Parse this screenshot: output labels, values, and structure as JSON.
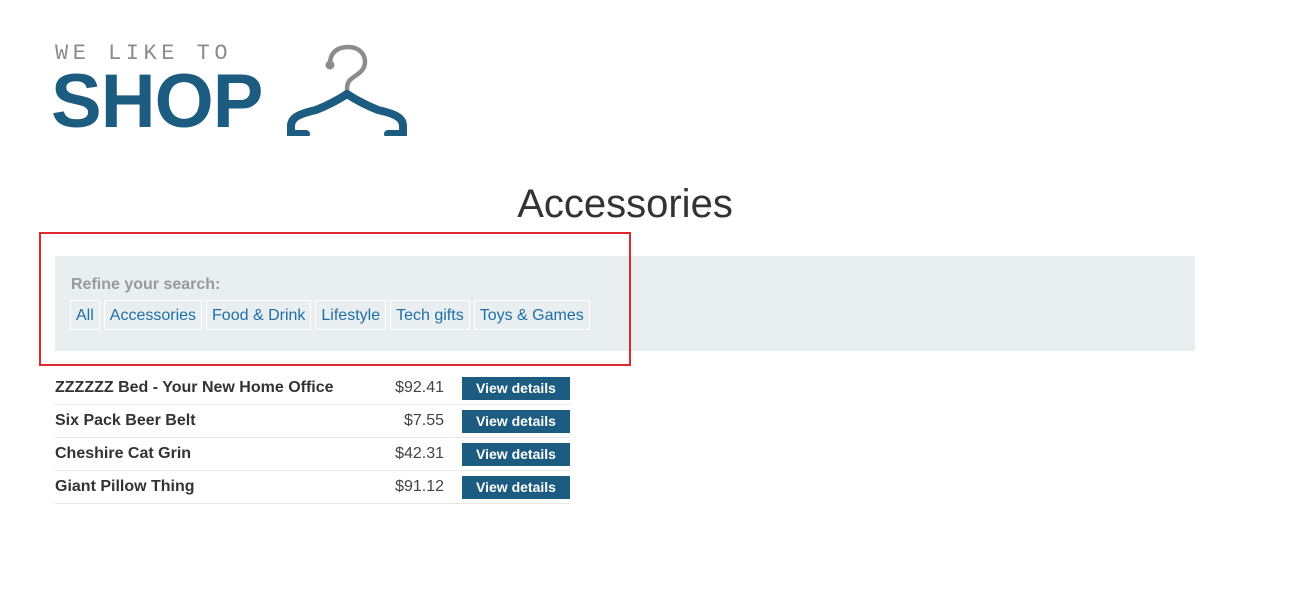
{
  "logo": {
    "tagline": "WE LIKE TO",
    "word": "SHOP",
    "icon": "hanger-icon",
    "colors": {
      "primary": "#1b5c80",
      "secondary": "#8c8c8c"
    }
  },
  "page_title": "Accessories",
  "filter": {
    "label": "Refine your search:",
    "links": [
      {
        "label": "All"
      },
      {
        "label": "Accessories"
      },
      {
        "label": "Food & Drink"
      },
      {
        "label": "Lifestyle"
      },
      {
        "label": "Tech gifts"
      },
      {
        "label": "Toys & Games"
      }
    ]
  },
  "products": [
    {
      "name": "ZZZZZZ Bed - Your New Home Office",
      "price": "$92.41",
      "button": "View details"
    },
    {
      "name": "Six Pack Beer Belt",
      "price": "$7.55",
      "button": "View details"
    },
    {
      "name": "Cheshire Cat Grin",
      "price": "$42.31",
      "button": "View details"
    },
    {
      "name": "Giant Pillow Thing",
      "price": "$91.12",
      "button": "View details"
    }
  ],
  "colors": {
    "accent": "#1b5c80",
    "link": "#1e6fa8",
    "panel": "#e9eef1",
    "highlight": "#e0282e"
  }
}
